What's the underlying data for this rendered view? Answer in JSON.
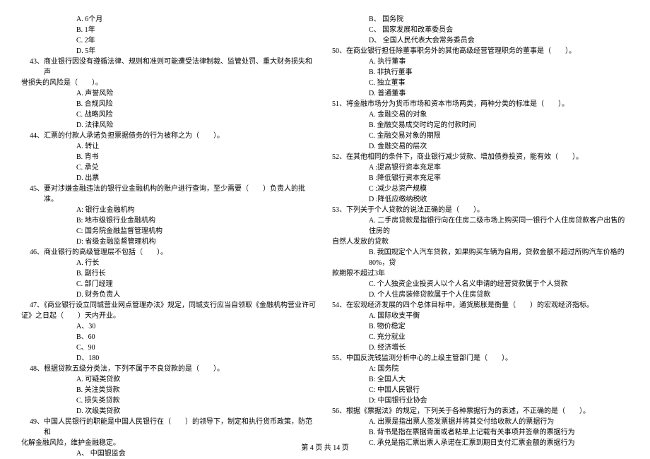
{
  "left": {
    "q42_options": {
      "a": "A. 6个月",
      "b": "B. 1年",
      "c": "C. 2年",
      "d": "D. 5年"
    },
    "q43": {
      "stem_line1": "43、商业银行因没有遵循法律、规则和准则可能遭受法律制裁、监管处罚、重大财务损失和声",
      "stem_line2": "誉损失的风险是（　　）。",
      "a": "A. 声誉风险",
      "b": "B. 合规风险",
      "c": "C. 战略风险",
      "d": "D. 法律风险"
    },
    "q44": {
      "stem": "44、汇票的付款人承诺负担票据债务的行为被称之为（　　）。",
      "a": "A. 转让",
      "b": "B. 背书",
      "c": "C. 承兑",
      "d": "D. 出票"
    },
    "q45": {
      "stem": "45、要对涉嫌金融违法的银行业金融机构的账户进行查询，至少需要（　　）负责人的批准。",
      "a": "A: 银行业金融机构",
      "b": "B: 地市级银行业金融机构",
      "c": "C: 国务院金融监督管理机构",
      "d": "D: 省级金融监督管理机构"
    },
    "q46": {
      "stem": "46、商业银行的高级管理层不包括（　　）。",
      "a": "A. 行长",
      "b": "B. 副行长",
      "c": "C. 部门经理",
      "d": "D. 财务负责人"
    },
    "q47": {
      "stem_line1": "47、《商业银行设立同城营业网点管理办法》规定，同城支行应当自领取《金融机构营业许可",
      "stem_line2": "证》之日起（　　）天内开业。",
      "a": "A、30",
      "b": "B、60",
      "c": "C、90",
      "d": "D、180"
    },
    "q48": {
      "stem": "48、根据贷款五级分类法，下列不属于不良贷款的是（　　）。",
      "a": "A. 可疑类贷款",
      "b": "B. 关注类贷款",
      "c": "C. 损失类贷款",
      "d": "D. 次级类贷款"
    },
    "q49": {
      "stem_line1": "49、中国人民银行的职能是中国人民银行在（　　）的领导下，制定和执行货币政策，防范和",
      "stem_line2": "化解金融风险，维护金融稳定。",
      "a": "A、 中国银监会"
    }
  },
  "right": {
    "q49_cont": {
      "b": "B、 国务院",
      "c": "C、 国家发展和改革委员会",
      "d": "D、 全国人民代表大会常务委员会"
    },
    "q50": {
      "stem": "50、在商业银行担任除董事职务外的其他高级经营管理职务的董事是（　　）。",
      "a": "A. 执行董事",
      "b": "B. 非执行董事",
      "c": "C. 独立董事",
      "d": "D. 普通董事"
    },
    "q51": {
      "stem": "51、将金融市场分为货币市场和资本市场两类，两种分类的标准是（　　）。",
      "a": "A. 金融交易的对象",
      "b": "B. 金融交易成交时约定的付款时间",
      "c": "C. 金融交易对象的期限",
      "d": "D. 金融交易的层次"
    },
    "q52": {
      "stem": "52、在其他相同的条件下，商业银行减少贷款、增加债券投资，能有效（　　）。",
      "a": "A :提高银行资本充足率",
      "b": "B :降低银行资本充足率",
      "c": "C :减少总资产规模",
      "d": "D :降低应缴纳税收"
    },
    "q53": {
      "stem": "53、下列关于个人贷款的说法正确的是（　　）。",
      "a_line1": "A. 二手房贷款是指银行向在住房二级市场上购买同一银行个人住房贷款客户出售的住房的",
      "a_line2": "自然人发放的贷款",
      "b_line1": "B. 我国规定个人汽车贷款，如果购买车辆为自用，贷款金额不超过所购汽车价格的80%，贷",
      "b_line2": "款期限不超过3年",
      "c": "C. 个人独资企业投资人以个人名义申请的经营贷款属于个人贷款",
      "d": "D. 个人住房装修贷款属于个人住房贷款"
    },
    "q54": {
      "stem": "54、在宏观经济发展的四个总体目标中，通货膨胀是衡量（　　）的宏观经济指标。",
      "a": "A. 国际收支平衡",
      "b": "B. 物价稳定",
      "c": "C. 充分就业",
      "d": "D. 经济增长"
    },
    "q55": {
      "stem": "55、中国反洗钱监测分析中心的上级主管部门是（　　）。",
      "a": "A: 国务院",
      "b": "B: 全国人大",
      "c": "C: 中国人民银行",
      "d": "D: 中国银行业协会"
    },
    "q56": {
      "stem": "56、根据《票据法》的规定，下列关于各种票据行为的表述，不正确的是（　　）。",
      "a": "A. 出票是指出票人签发票据并将其交付给收款人的票据行为",
      "b": "B. 背书是指在票据背面或者粘单上记载有关事项并签章的票据行为",
      "c": "C. 承兑是指汇票出票人承诺在汇票到期日支付汇票金额的票据行为"
    }
  },
  "footer": "第 4 页 共 14 页"
}
